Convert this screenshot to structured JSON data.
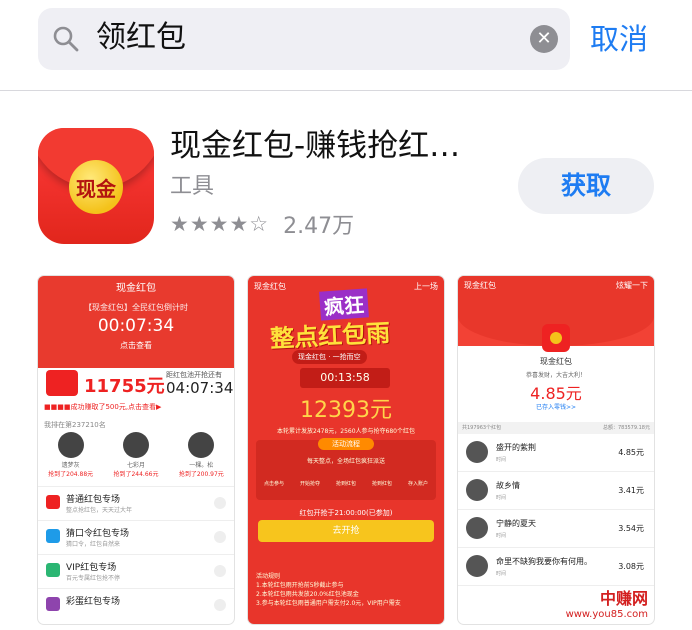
{
  "search": {
    "query": "领红包",
    "cancel_label": "取消"
  },
  "app": {
    "icon_text": "现金",
    "title": "现金红包-赚钱抢红…",
    "category": "工具",
    "stars": 4.5,
    "stars_display": "★★★★☆",
    "rating_count": "2.47万",
    "get_label": "获取"
  },
  "shot1": {
    "nav_title": "现金红包",
    "sub": "【现金红包】全民红包倒计时",
    "timer": "00:07:34",
    "link": "点击查看",
    "amount": "11755元",
    "right_label": "距红包池开抢还有",
    "right_timer": "04:07:34",
    "notice": "■■■■成功赚取了500元,点击查看▶",
    "rank_label": "我排在第237210名",
    "avatars": [
      {
        "name": "遗梦灰",
        "value": "抢到了204.88元"
      },
      {
        "name": "七彩月",
        "value": "抢到了244.66元"
      },
      {
        "name": "一棵。松",
        "value": "抢到了200.97元"
      }
    ],
    "list": [
      {
        "title": "普通红包专场",
        "desc": "整点抢红包，天天过大年",
        "color": "#e22"
      },
      {
        "title": "猜口令红包专场",
        "desc": "猜口令，红包自然来",
        "color": "#1e9be8"
      },
      {
        "title": "VIP红包专场",
        "desc": "百元专属红包抢不停",
        "color": "#2bb673"
      },
      {
        "title": "彩蛋红包专场",
        "desc": "",
        "color": "#8e44ad"
      }
    ]
  },
  "shot2": {
    "nav_back": "现金红包",
    "nav_right": "上一场",
    "title1": "疯狂",
    "title2": "整点红包雨",
    "tags": "现金红包 · 一抢而空",
    "timer": "00:13:58",
    "amount": "12393元",
    "desc": "本轮累计发放2478元，2560人参与抢夺680个红包",
    "rules_head": "活动流程",
    "rules_body": "每天整点，全场红包疯狂派送",
    "steps": [
      "点击参与",
      "开始抢夺",
      "抢到红包",
      "抢到红包",
      "存入账户"
    ],
    "start_text": "红包开抢于21:00:00(已参加)",
    "button": "去开抢",
    "footer": "活动规则\n1.本轮红包雨开抢前5秒截止参与\n2.本轮红包雨共发放20.0%红包池现金\n3.参与本轮红包雨普通用户需支付2.0元，VIP用户需支"
  },
  "shot3": {
    "nav_back": "现金红包",
    "nav_right": "炫耀一下",
    "name": "现金红包",
    "greet": "恭喜发财，大吉大利！",
    "amount": "4.85元",
    "saved": "已存入零钱>>",
    "bar_left": "共197963个红包",
    "bar_right": "总额：783579.18元",
    "rows": [
      {
        "name": "盛开的紫荆",
        "time": "时间",
        "amount": "4.85元"
      },
      {
        "name": "故乡情",
        "time": "时间",
        "amount": "3.41元"
      },
      {
        "name": "宁静的夏天",
        "time": "时间",
        "amount": "3.54元"
      },
      {
        "name": "命里不缺狗我要你有何用。",
        "time": "时间",
        "amount": "3.08元"
      }
    ]
  },
  "watermark": {
    "line1": "中赚网",
    "line2": "www.you85.com"
  },
  "colors": {
    "accent": "#1e7cf2",
    "brand_red": "#e22"
  }
}
